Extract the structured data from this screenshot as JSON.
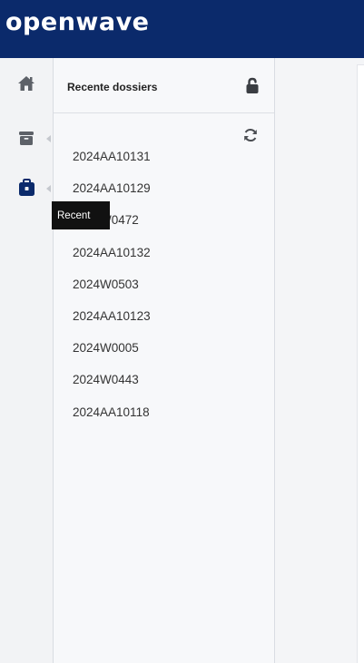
{
  "brand": {
    "name": "openwave"
  },
  "sidebar": {
    "items": [
      {
        "name": "home",
        "icon": "home-icon"
      },
      {
        "name": "files",
        "icon": "folder-icon"
      },
      {
        "name": "recent",
        "icon": "briefcase-icon",
        "active": true
      }
    ],
    "tooltip": "Recent"
  },
  "panel": {
    "title": "Recente dossiers",
    "lock_icon": "lock-open-icon",
    "refresh_icon": "refresh-icon",
    "dossiers": [
      "2024AA10131",
      "2024AA10129",
      "2024W0472",
      "2024AA10132",
      "2024W0503",
      "2024AA10123",
      "2024W0005",
      "2024W0443",
      "2024AA10118"
    ]
  },
  "colors": {
    "header_bg": "#0b2a6b",
    "icon_gray": "#5d6168",
    "icon_active": "#0b2a6b"
  }
}
